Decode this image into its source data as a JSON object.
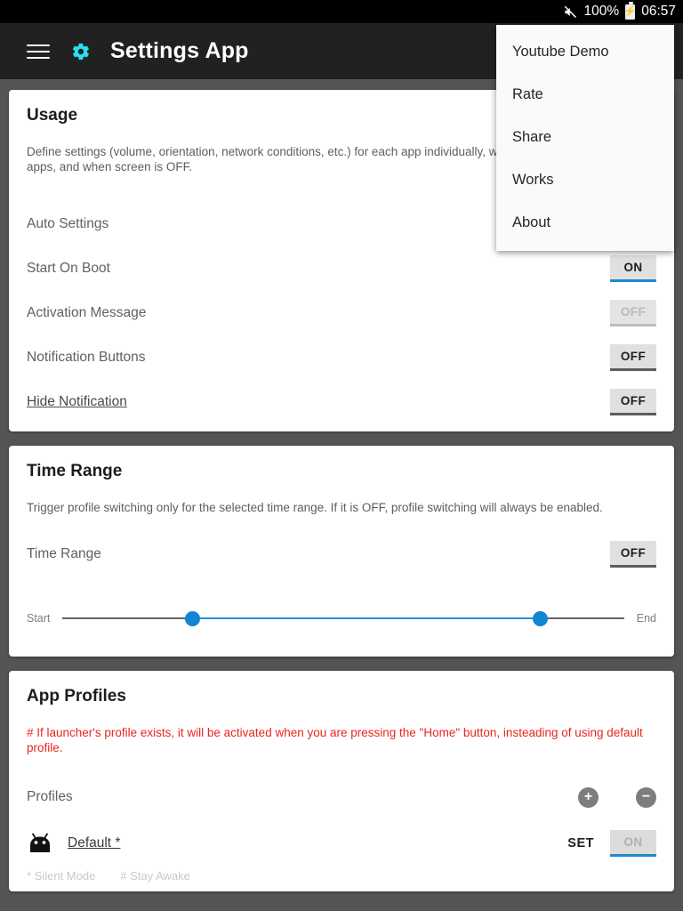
{
  "statusbar": {
    "mute_icon": "volume-off-icon",
    "battery_percent": "100%",
    "battery_icon": "battery-charging-icon",
    "clock": "06:57"
  },
  "appbar": {
    "menu_icon": "hamburger-menu-icon",
    "app_icon": "gear-icon",
    "title": "Settings App",
    "accent_color": "#2ae0f0",
    "background_color": "#212121"
  },
  "overflow_menu": {
    "items": [
      {
        "label": "Youtube Demo"
      },
      {
        "label": "Rate"
      },
      {
        "label": "Share"
      },
      {
        "label": "Works"
      },
      {
        "label": "About"
      }
    ]
  },
  "usage_card": {
    "title": "Usage",
    "description": "Define settings (volume, orientation, network conditions, etc.) for each app individually, when you are running all other apps, and when screen is OFF.",
    "rows": [
      {
        "label": "Auto Settings",
        "value": "",
        "state": "none"
      },
      {
        "label": "Start On Boot",
        "value": "ON",
        "state": "on"
      },
      {
        "label": "Activation Message",
        "value": "OFF",
        "state": "disabled"
      },
      {
        "label": "Notification Buttons",
        "value": "OFF",
        "state": "off"
      },
      {
        "label": "Hide Notification",
        "value": "OFF",
        "state": "off"
      }
    ]
  },
  "time_range_card": {
    "title": "Time Range",
    "description": "Trigger profile switching only for the selected time range. If it is OFF, profile switching will always be enabled.",
    "row_label": "Time Range",
    "row_value": "OFF",
    "slider": {
      "start_label": "Start",
      "end_label": "End",
      "start_percent": 23,
      "end_percent": 85,
      "track_color": "#2196d8",
      "thumb_color": "#1186d2"
    }
  },
  "app_profiles_card": {
    "title": "App Profiles",
    "notice": "# If launcher's profile exists, it will be activated when you are pressing the \"Home\" button, insteading of using default profile.",
    "notice_color": "#e8251f",
    "profiles_label": "Profiles",
    "add_icon": "plus-circle-icon",
    "remove_icon": "minus-circle-icon",
    "profile": {
      "icon": "android-robot-icon",
      "name": "Default *",
      "set_label": "SET",
      "toggle_value": "ON",
      "flags": [
        "* Silent Mode",
        "# Stay Awake"
      ]
    }
  }
}
